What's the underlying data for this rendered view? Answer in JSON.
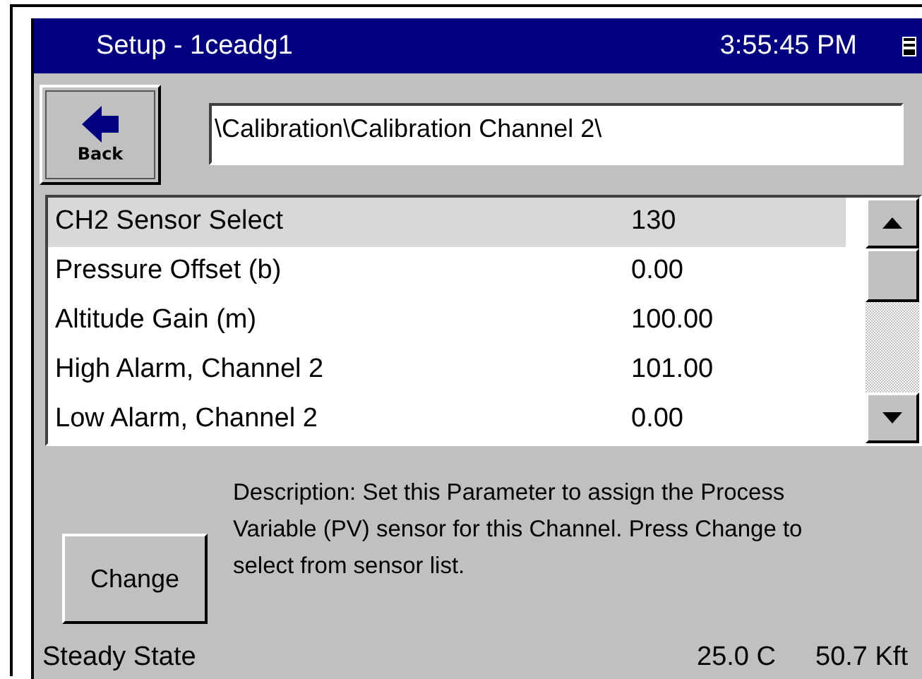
{
  "window": {
    "title": "Setup - 1ceadg1",
    "time": "3:55:45 PM"
  },
  "toolbar": {
    "back_button": "Back",
    "path": "\\Calibration\\Calibration Channel 2\\"
  },
  "parameters": [
    {
      "label": "CH2 Sensor Select",
      "value": "130",
      "selected": true
    },
    {
      "label": "Pressure Offset (b)",
      "value": "0.00",
      "selected": false
    },
    {
      "label": "Altitude Gain (m)",
      "value": "100.00",
      "selected": false
    },
    {
      "label": "High Alarm, Channel 2",
      "value": "101.00",
      "selected": false
    },
    {
      "label": "Low Alarm, Channel 2",
      "value": "0.00",
      "selected": false
    }
  ],
  "description": "Description:  Set this Parameter to assign the Process Variable (PV) sensor for this Channel. Press Change to select from sensor list.",
  "change_button": "Change",
  "status_bar": {
    "state": "Steady State",
    "temperature": "25.0 C",
    "altitude": "50.7 Kft"
  }
}
